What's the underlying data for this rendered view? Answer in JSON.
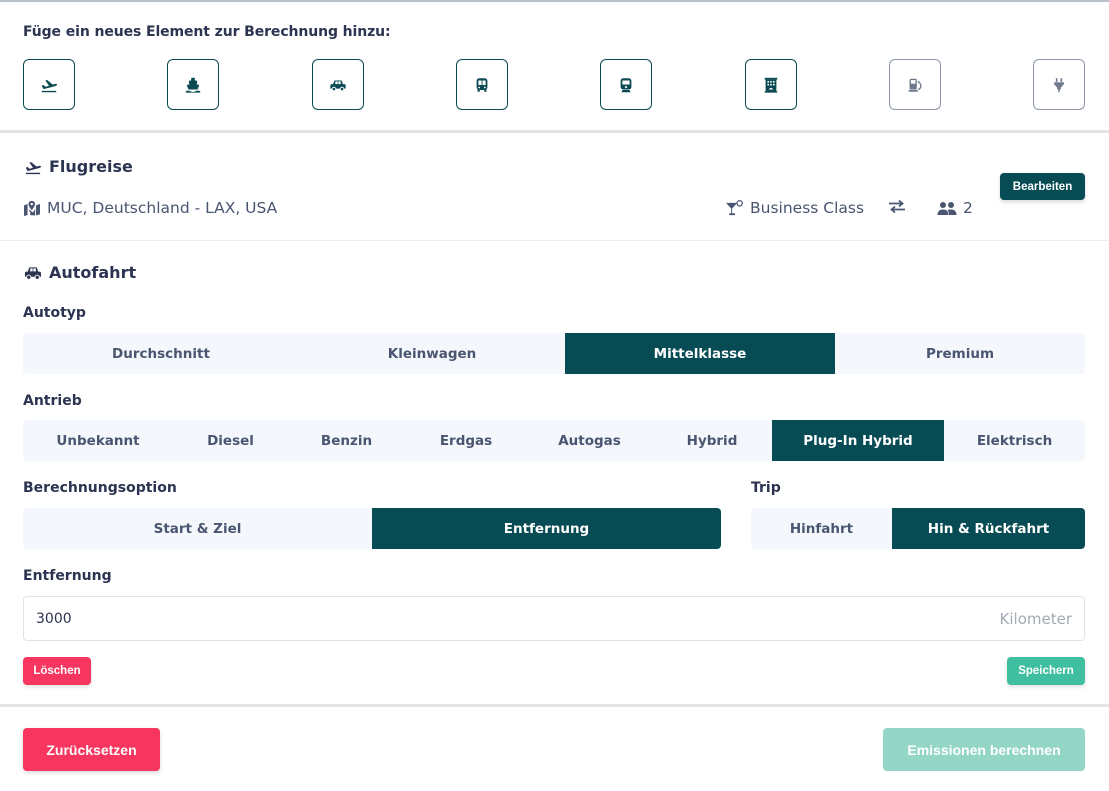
{
  "add_section": {
    "title": "Füge ein neues Element zur Berechnung hinzu:",
    "buttons": [
      {
        "icon": "plane-departure-icon",
        "label": "Flugreise",
        "enabled": true
      },
      {
        "icon": "ship-icon",
        "label": "Schiff",
        "enabled": true
      },
      {
        "icon": "car-icon",
        "label": "Auto",
        "enabled": true
      },
      {
        "icon": "bus-icon",
        "label": "Bus",
        "enabled": true
      },
      {
        "icon": "train-icon",
        "label": "Zug",
        "enabled": true
      },
      {
        "icon": "hotel-icon",
        "label": "Hotel",
        "enabled": true
      },
      {
        "icon": "gas-pump-icon",
        "label": "Kraftstoff",
        "enabled": false
      },
      {
        "icon": "plug-icon",
        "label": "Strom",
        "enabled": false
      }
    ]
  },
  "flight": {
    "title": "Flugreise",
    "route": "MUC, Deutschland - LAX, USA",
    "class": "Business Class",
    "trip_icon": "exchange-icon",
    "passengers": "2",
    "edit_label": "Bearbeiten"
  },
  "car": {
    "title": "Autofahrt",
    "car_type": {
      "label": "Autotyp",
      "options": [
        "Durchschnitt",
        "Kleinwagen",
        "Mittelklasse",
        "Premium"
      ],
      "selected": "Mittelklasse"
    },
    "drive": {
      "label": "Antrieb",
      "options": [
        "Unbekannt",
        "Diesel",
        "Benzin",
        "Erdgas",
        "Autogas",
        "Hybrid",
        "Plug-In Hybrid",
        "Elektrisch"
      ],
      "selected": "Plug-In Hybrid"
    },
    "calc_option": {
      "label": "Berechnungsoption",
      "options": [
        "Start & Ziel",
        "Entfernung"
      ],
      "selected": "Entfernung"
    },
    "trip": {
      "label": "Trip",
      "options": [
        "Hinfahrt",
        "Hin & Rückfahrt"
      ],
      "selected": "Hin & Rückfahrt"
    },
    "distance": {
      "label": "Entfernung",
      "value": "3000",
      "unit": "Kilometer"
    },
    "delete_label": "Löschen",
    "save_label": "Speichern"
  },
  "footer": {
    "reset_label": "Zurücksetzen",
    "calculate_label": "Emissionen berechnen"
  },
  "colors": {
    "primary": "#074c55",
    "danger": "#f6365f",
    "success": "#3fbf9f",
    "success_disabled": "#94d6c5",
    "text": "#2d3452",
    "muted": "#4a5571"
  }
}
